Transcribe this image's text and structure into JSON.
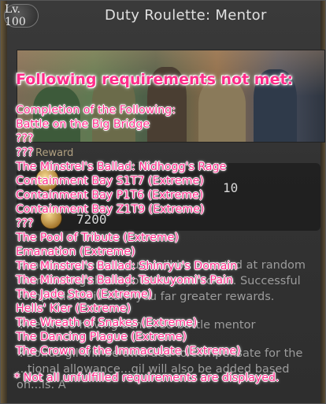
{
  "window": {
    "level": "Lv. 100",
    "title": "Duty Roulette: Mentor"
  },
  "reward": {
    "section_label": "Reward",
    "value_1": "10",
    "value_2": "7200"
  },
  "description": {
    "line1": "A mentor-oriented duty will be selected at random",
    "line2": "from among those you have unlocked. Successful",
    "line3": "completion will earn you far greater rewards.",
    "line4": "※Requires having achieved battle mentor",
    "line5": "※Bonus gil will be awarded to compensate for the",
    "line6": "...tional allowance...gil will also be added based on...ls. A"
  },
  "tooltip": {
    "heading": "Following requirements not met:",
    "items": [
      "Completion of the Following:",
      "Battle on the Big Bridge",
      "???",
      "???",
      "The Minstrel's Ballad: Nidhogg's Rage",
      "Containment Bay S1T7 (Extreme)",
      "Containment Bay P1T6 (Extreme)",
      "Containment Bay Z1T9 (Extreme)",
      "???",
      "The Pool of Tribute (Extreme)",
      "Emanation (Extreme)",
      "The Minstrel's Ballad: Shinryu's Domain",
      "The Minstrel's Ballad: Tsukuyomi's Pain",
      "The Jade Stoa (Extreme)",
      "Hells' Kier (Extreme)",
      "The Wreath of Snakes (Extreme)",
      "The Dancing Plague (Extreme)",
      "The Crown of the Immaculate (Extreme)"
    ],
    "footnote": "* Not all unfulfilled requirements are displayed."
  }
}
